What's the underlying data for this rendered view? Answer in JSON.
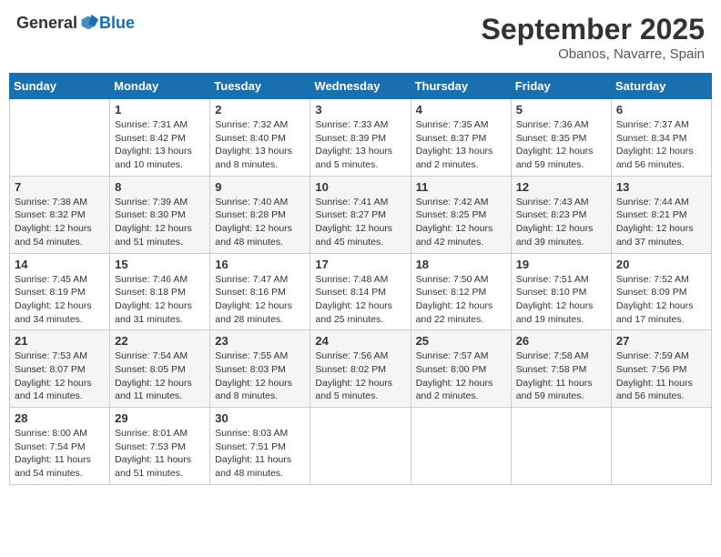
{
  "header": {
    "logo_general": "General",
    "logo_blue": "Blue",
    "month": "September 2025",
    "location": "Obanos, Navarre, Spain"
  },
  "days_of_week": [
    "Sunday",
    "Monday",
    "Tuesday",
    "Wednesday",
    "Thursday",
    "Friday",
    "Saturday"
  ],
  "weeks": [
    [
      {
        "day": "",
        "info": ""
      },
      {
        "day": "1",
        "info": "Sunrise: 7:31 AM\nSunset: 8:42 PM\nDaylight: 13 hours\nand 10 minutes."
      },
      {
        "day": "2",
        "info": "Sunrise: 7:32 AM\nSunset: 8:40 PM\nDaylight: 13 hours\nand 8 minutes."
      },
      {
        "day": "3",
        "info": "Sunrise: 7:33 AM\nSunset: 8:39 PM\nDaylight: 13 hours\nand 5 minutes."
      },
      {
        "day": "4",
        "info": "Sunrise: 7:35 AM\nSunset: 8:37 PM\nDaylight: 13 hours\nand 2 minutes."
      },
      {
        "day": "5",
        "info": "Sunrise: 7:36 AM\nSunset: 8:35 PM\nDaylight: 12 hours\nand 59 minutes."
      },
      {
        "day": "6",
        "info": "Sunrise: 7:37 AM\nSunset: 8:34 PM\nDaylight: 12 hours\nand 56 minutes."
      }
    ],
    [
      {
        "day": "7",
        "info": "Sunrise: 7:38 AM\nSunset: 8:32 PM\nDaylight: 12 hours\nand 54 minutes."
      },
      {
        "day": "8",
        "info": "Sunrise: 7:39 AM\nSunset: 8:30 PM\nDaylight: 12 hours\nand 51 minutes."
      },
      {
        "day": "9",
        "info": "Sunrise: 7:40 AM\nSunset: 8:28 PM\nDaylight: 12 hours\nand 48 minutes."
      },
      {
        "day": "10",
        "info": "Sunrise: 7:41 AM\nSunset: 8:27 PM\nDaylight: 12 hours\nand 45 minutes."
      },
      {
        "day": "11",
        "info": "Sunrise: 7:42 AM\nSunset: 8:25 PM\nDaylight: 12 hours\nand 42 minutes."
      },
      {
        "day": "12",
        "info": "Sunrise: 7:43 AM\nSunset: 8:23 PM\nDaylight: 12 hours\nand 39 minutes."
      },
      {
        "day": "13",
        "info": "Sunrise: 7:44 AM\nSunset: 8:21 PM\nDaylight: 12 hours\nand 37 minutes."
      }
    ],
    [
      {
        "day": "14",
        "info": "Sunrise: 7:45 AM\nSunset: 8:19 PM\nDaylight: 12 hours\nand 34 minutes."
      },
      {
        "day": "15",
        "info": "Sunrise: 7:46 AM\nSunset: 8:18 PM\nDaylight: 12 hours\nand 31 minutes."
      },
      {
        "day": "16",
        "info": "Sunrise: 7:47 AM\nSunset: 8:16 PM\nDaylight: 12 hours\nand 28 minutes."
      },
      {
        "day": "17",
        "info": "Sunrise: 7:48 AM\nSunset: 8:14 PM\nDaylight: 12 hours\nand 25 minutes."
      },
      {
        "day": "18",
        "info": "Sunrise: 7:50 AM\nSunset: 8:12 PM\nDaylight: 12 hours\nand 22 minutes."
      },
      {
        "day": "19",
        "info": "Sunrise: 7:51 AM\nSunset: 8:10 PM\nDaylight: 12 hours\nand 19 minutes."
      },
      {
        "day": "20",
        "info": "Sunrise: 7:52 AM\nSunset: 8:09 PM\nDaylight: 12 hours\nand 17 minutes."
      }
    ],
    [
      {
        "day": "21",
        "info": "Sunrise: 7:53 AM\nSunset: 8:07 PM\nDaylight: 12 hours\nand 14 minutes."
      },
      {
        "day": "22",
        "info": "Sunrise: 7:54 AM\nSunset: 8:05 PM\nDaylight: 12 hours\nand 11 minutes."
      },
      {
        "day": "23",
        "info": "Sunrise: 7:55 AM\nSunset: 8:03 PM\nDaylight: 12 hours\nand 8 minutes."
      },
      {
        "day": "24",
        "info": "Sunrise: 7:56 AM\nSunset: 8:02 PM\nDaylight: 12 hours\nand 5 minutes."
      },
      {
        "day": "25",
        "info": "Sunrise: 7:57 AM\nSunset: 8:00 PM\nDaylight: 12 hours\nand 2 minutes."
      },
      {
        "day": "26",
        "info": "Sunrise: 7:58 AM\nSunset: 7:58 PM\nDaylight: 11 hours\nand 59 minutes."
      },
      {
        "day": "27",
        "info": "Sunrise: 7:59 AM\nSunset: 7:56 PM\nDaylight: 11 hours\nand 56 minutes."
      }
    ],
    [
      {
        "day": "28",
        "info": "Sunrise: 8:00 AM\nSunset: 7:54 PM\nDaylight: 11 hours\nand 54 minutes."
      },
      {
        "day": "29",
        "info": "Sunrise: 8:01 AM\nSunset: 7:53 PM\nDaylight: 11 hours\nand 51 minutes."
      },
      {
        "day": "30",
        "info": "Sunrise: 8:03 AM\nSunset: 7:51 PM\nDaylight: 11 hours\nand 48 minutes."
      },
      {
        "day": "",
        "info": ""
      },
      {
        "day": "",
        "info": ""
      },
      {
        "day": "",
        "info": ""
      },
      {
        "day": "",
        "info": ""
      }
    ]
  ]
}
